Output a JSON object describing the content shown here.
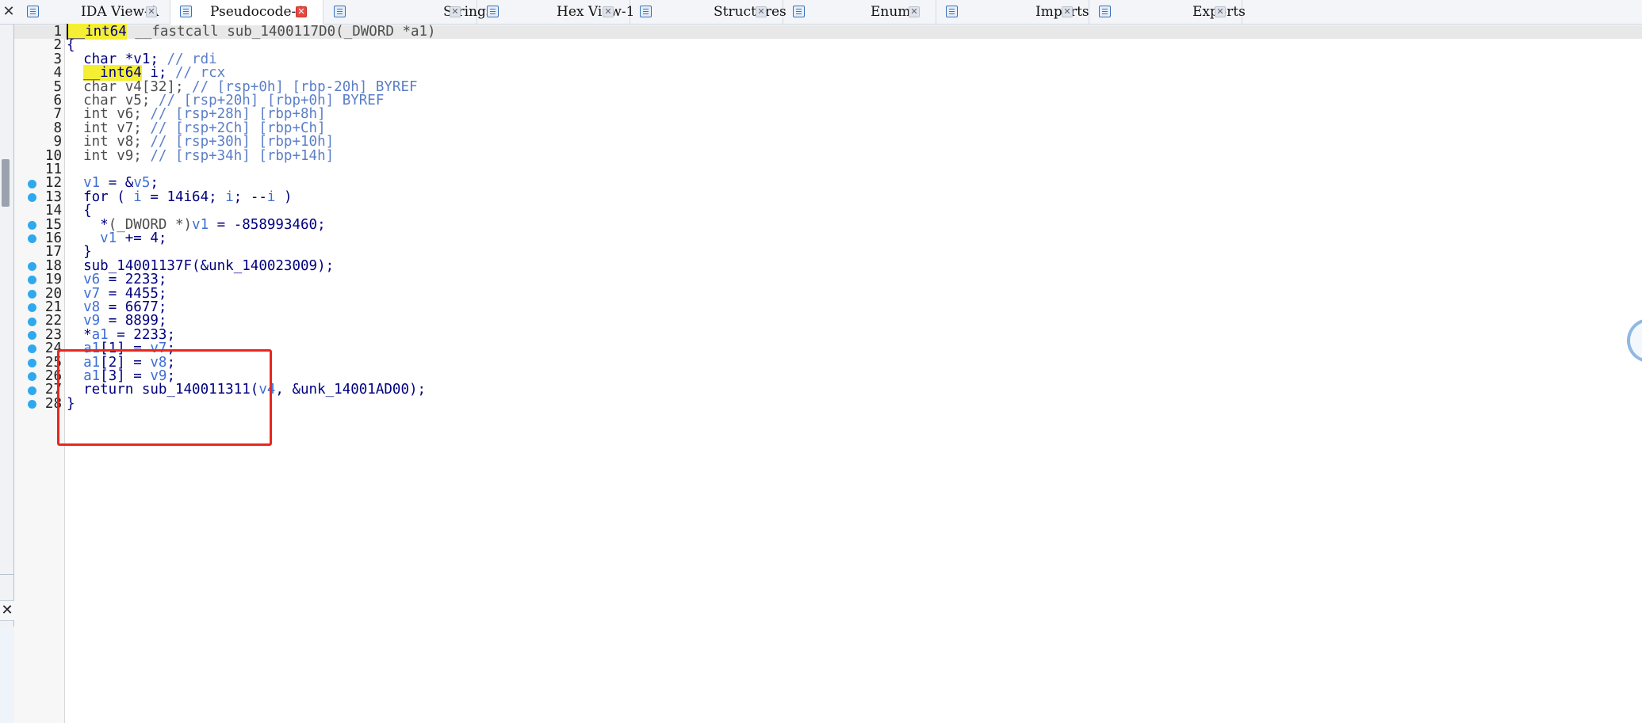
{
  "tabs": [
    {
      "label": "IDA View-A",
      "icon": "ida-view-icon"
    },
    {
      "label": "Pseudocode-A",
      "icon": "pseudocode-icon",
      "active": true
    },
    {
      "label": "Strings",
      "icon": "strings-icon"
    },
    {
      "label": "Hex View-1",
      "icon": "hex-view-icon"
    },
    {
      "label": "Structures",
      "icon": "structures-icon"
    },
    {
      "label": "Enums",
      "icon": "enums-icon"
    },
    {
      "label": "Imports",
      "icon": "imports-icon"
    },
    {
      "label": "Exports",
      "icon": "exports-icon"
    }
  ],
  "left_close_glyph": "✕",
  "panel_close_glyph": "✕",
  "tab_close_glyph": "✕",
  "code": {
    "current_line": 1,
    "highlighted_lines": [
      19,
      23
    ],
    "lines": [
      {
        "n": "1",
        "dot": false,
        "tokens": [
          [
            "hl",
            "__int64"
          ],
          [
            "dim",
            " __fastcall sub_1400117D0(_DWORD *a1)"
          ]
        ]
      },
      {
        "n": "2",
        "dot": false,
        "tokens": [
          [
            "kw",
            "{"
          ]
        ]
      },
      {
        "n": "3",
        "dot": false,
        "tokens": [
          [
            "kw",
            "  char *v1; "
          ],
          [
            "cm",
            "// rdi"
          ]
        ]
      },
      {
        "n": "4",
        "dot": false,
        "tokens": [
          [
            "kw",
            "  "
          ],
          [
            "hl",
            "__int64"
          ],
          [
            "kw",
            " i; "
          ],
          [
            "cm",
            "// rcx"
          ]
        ]
      },
      {
        "n": "5",
        "dot": false,
        "tokens": [
          [
            "dim",
            "  char v4[32]; "
          ],
          [
            "cm",
            "// [rsp+0h] [rbp-20h] BYREF"
          ]
        ]
      },
      {
        "n": "6",
        "dot": false,
        "tokens": [
          [
            "dim",
            "  char v5; "
          ],
          [
            "cm",
            "// [rsp+20h] [rbp+0h] BYREF"
          ]
        ]
      },
      {
        "n": "7",
        "dot": false,
        "tokens": [
          [
            "dim",
            "  int v6; "
          ],
          [
            "cm",
            "// [rsp+28h] [rbp+8h]"
          ]
        ]
      },
      {
        "n": "8",
        "dot": false,
        "tokens": [
          [
            "dim",
            "  int v7; "
          ],
          [
            "cm",
            "// [rsp+2Ch] [rbp+Ch]"
          ]
        ]
      },
      {
        "n": "9",
        "dot": false,
        "tokens": [
          [
            "dim",
            "  int v8; "
          ],
          [
            "cm",
            "// [rsp+30h] [rbp+10h]"
          ]
        ]
      },
      {
        "n": "10",
        "dot": false,
        "tokens": [
          [
            "dim",
            "  int v9; "
          ],
          [
            "cm",
            "// [rsp+34h] [rbp+14h]"
          ]
        ]
      },
      {
        "n": "11",
        "dot": false,
        "tokens": []
      },
      {
        "n": "12",
        "dot": true,
        "tokens": [
          [
            "var",
            "  v1"
          ],
          [
            "kw",
            " = &"
          ],
          [
            "var",
            "v5"
          ],
          [
            "kw",
            ";"
          ]
        ]
      },
      {
        "n": "13",
        "dot": true,
        "tokens": [
          [
            "kw",
            "  for ( "
          ],
          [
            "var",
            "i"
          ],
          [
            "kw",
            " = 14i64; "
          ],
          [
            "var",
            "i"
          ],
          [
            "kw",
            "; --"
          ],
          [
            "var",
            "i"
          ],
          [
            "kw",
            " )"
          ]
        ]
      },
      {
        "n": "14",
        "dot": false,
        "tokens": [
          [
            "kw",
            "  {"
          ]
        ]
      },
      {
        "n": "15",
        "dot": true,
        "tokens": [
          [
            "kw",
            "    *"
          ],
          [
            "dim",
            "(_DWORD *)"
          ],
          [
            "var",
            "v1"
          ],
          [
            "kw",
            " = -858993460;"
          ]
        ]
      },
      {
        "n": "16",
        "dot": true,
        "tokens": [
          [
            "var",
            "    v1"
          ],
          [
            "kw",
            " += 4;"
          ]
        ]
      },
      {
        "n": "17",
        "dot": false,
        "tokens": [
          [
            "kw",
            "  }"
          ]
        ]
      },
      {
        "n": "18",
        "dot": true,
        "tokens": [
          [
            "kw",
            "  sub_14001137F(&unk_140023009);"
          ]
        ]
      },
      {
        "n": "19",
        "dot": true,
        "tokens": [
          [
            "var",
            "  v6"
          ],
          [
            "kw",
            " = 2233;"
          ]
        ]
      },
      {
        "n": "20",
        "dot": true,
        "tokens": [
          [
            "var",
            "  v7"
          ],
          [
            "kw",
            " = 4455;"
          ]
        ]
      },
      {
        "n": "21",
        "dot": true,
        "tokens": [
          [
            "var",
            "  v8"
          ],
          [
            "kw",
            " = 6677;"
          ]
        ]
      },
      {
        "n": "22",
        "dot": true,
        "tokens": [
          [
            "var",
            "  v9"
          ],
          [
            "kw",
            " = 8899;"
          ]
        ]
      },
      {
        "n": "23",
        "dot": true,
        "tokens": [
          [
            "kw",
            "  *"
          ],
          [
            "var",
            "a1"
          ],
          [
            "kw",
            " = 2233;"
          ]
        ]
      },
      {
        "n": "24",
        "dot": true,
        "tokens": [
          [
            "var",
            "  a1"
          ],
          [
            "kw",
            "[1] = "
          ],
          [
            "var",
            "v7"
          ],
          [
            "kw",
            ";"
          ]
        ]
      },
      {
        "n": "25",
        "dot": true,
        "tokens": [
          [
            "var",
            "  a1"
          ],
          [
            "kw",
            "[2] = "
          ],
          [
            "var",
            "v8"
          ],
          [
            "kw",
            ";"
          ]
        ]
      },
      {
        "n": "26",
        "dot": true,
        "tokens": [
          [
            "var",
            "  a1"
          ],
          [
            "kw",
            "[3] = "
          ],
          [
            "var",
            "v9"
          ],
          [
            "kw",
            ";"
          ]
        ]
      },
      {
        "n": "27",
        "dot": true,
        "tokens": [
          [
            "kw",
            "  return sub_140011311("
          ],
          [
            "var",
            "v4"
          ],
          [
            "kw",
            ", &unk_14001AD00);"
          ]
        ]
      },
      {
        "n": "28",
        "dot": true,
        "tokens": [
          [
            "kw",
            "}"
          ]
        ]
      }
    ]
  },
  "colors": {
    "accent_tab_close": "#e9483f",
    "breakpoint_dot": "#2fa9ee",
    "highlight_box": "#e8271e",
    "keyword_highlight": "#f5ef33"
  }
}
